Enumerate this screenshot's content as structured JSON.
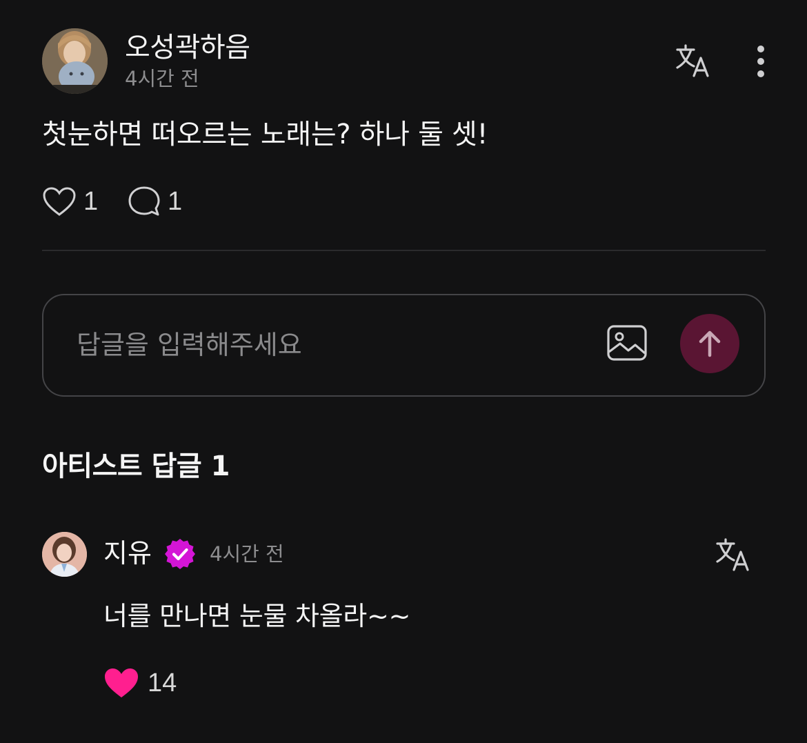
{
  "post": {
    "author": "오성곽하음",
    "time": "4시간 전",
    "body": "첫눈하면 떠오르는 노래는? 하나 둘 셋!",
    "like_count": "1",
    "comment_count": "1"
  },
  "reply_input": {
    "placeholder": "답글을 입력해주세요"
  },
  "artist_replies": {
    "title": "아티스트 답글 1",
    "items": [
      {
        "author": "지유",
        "verified": true,
        "time": "4시간 전",
        "body": "너를 만나면 눈물 차올라~~",
        "like_count": "14",
        "liked": true
      }
    ]
  },
  "icons": {
    "translate": "translate-icon",
    "more": "more-vertical-icon",
    "like": "heart-icon",
    "comment": "comment-bubble-icon",
    "image": "image-icon",
    "send": "arrow-up-icon",
    "verified": "verified-badge-icon"
  },
  "colors": {
    "background": "#121213",
    "send_button": "#5a1533",
    "verified_badge": "#d415d6",
    "liked_heart": "#ff1f8f"
  }
}
